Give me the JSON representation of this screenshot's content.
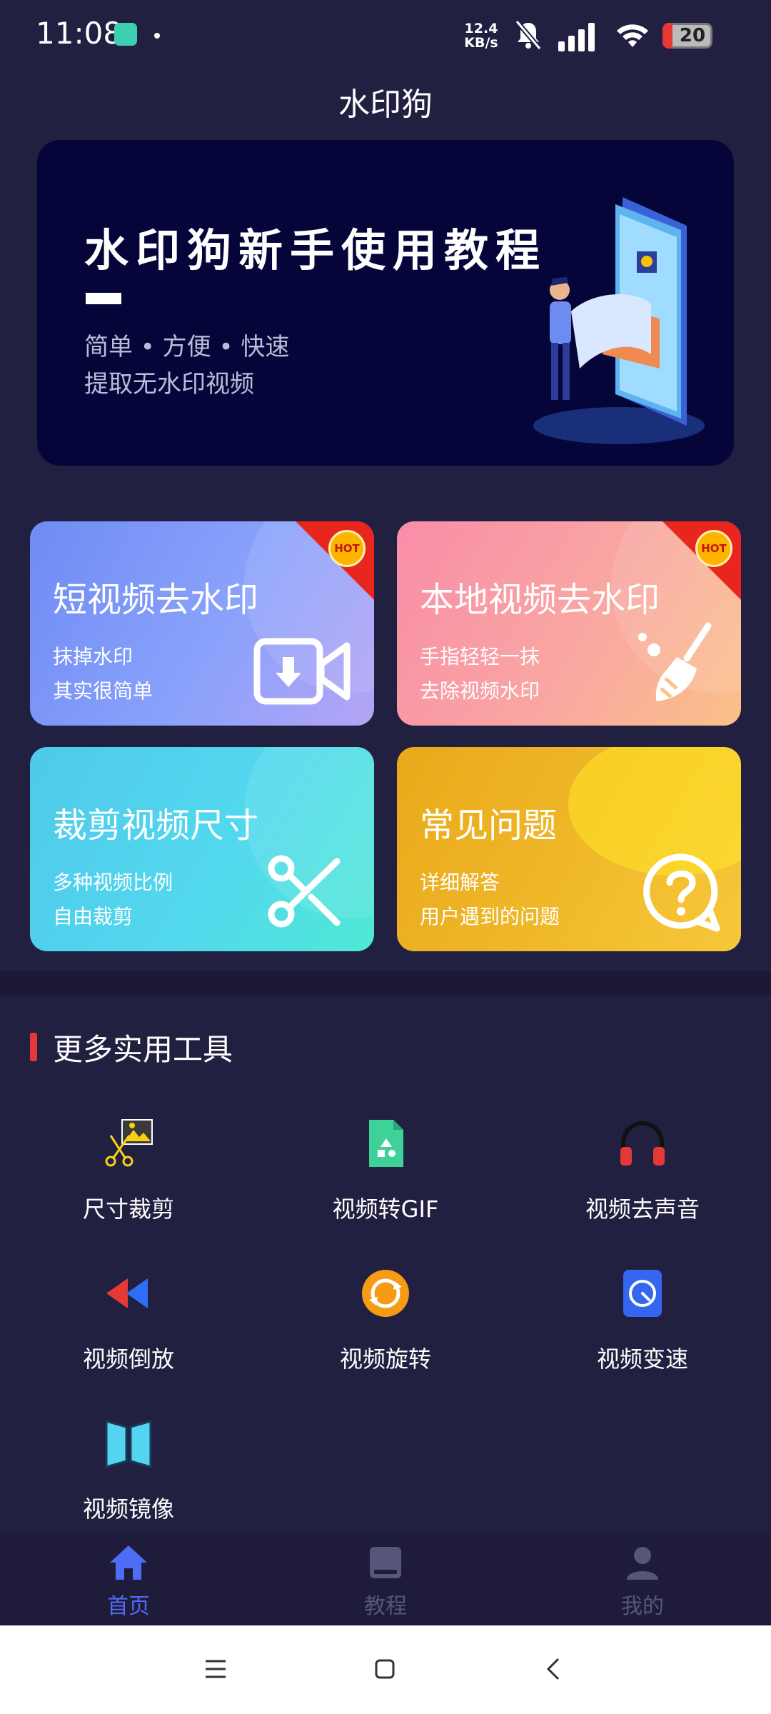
{
  "status_bar": {
    "time": "11:08",
    "net_speed_value": "12.4",
    "net_speed_unit": "KB/s",
    "battery": "20"
  },
  "app_title": "水印狗",
  "banner": {
    "title": "水印狗新手使用教程",
    "subtitle1": "简单 • 方便 • 快速",
    "subtitle2": "提取无水印视频"
  },
  "cards": [
    {
      "title": "短视频去水印",
      "line1": "抹掉水印",
      "line2": "其实很简单",
      "badge": "HOT",
      "icon": "video-download-icon"
    },
    {
      "title": "本地视频去水印",
      "line1": "手指轻轻一抹",
      "line2": "去除视频水印",
      "badge": "HOT",
      "icon": "broom-icon"
    },
    {
      "title": "裁剪视频尺寸",
      "line1": "多种视频比例",
      "line2": "自由裁剪",
      "icon": "scissors-icon"
    },
    {
      "title": "常见问题",
      "line1": "详细解答",
      "line2": "用户遇到的问题",
      "icon": "question-bubble-icon"
    }
  ],
  "section_title": "更多实用工具",
  "tools": [
    {
      "label": "尺寸裁剪",
      "icon": "crop-scissors-icon"
    },
    {
      "label": "视频转GIF",
      "icon": "gif-file-icon"
    },
    {
      "label": "视频去声音",
      "icon": "headphones-icon"
    },
    {
      "label": "视频倒放",
      "icon": "rewind-icon"
    },
    {
      "label": "视频旋转",
      "icon": "rotate-icon"
    },
    {
      "label": "视频变速",
      "icon": "speedometer-icon"
    },
    {
      "label": "视频镜像",
      "icon": "mirror-icon"
    }
  ],
  "bottom_nav": [
    {
      "label": "首页",
      "icon": "home-icon",
      "active": true
    },
    {
      "label": "教程",
      "icon": "book-icon",
      "active": false
    },
    {
      "label": "我的",
      "icon": "user-icon",
      "active": false
    }
  ],
  "colors": {
    "background": "#222040",
    "active_tab": "#4f6cf6",
    "inactive_tab": "#55567a",
    "hot_red": "#e8261e"
  }
}
